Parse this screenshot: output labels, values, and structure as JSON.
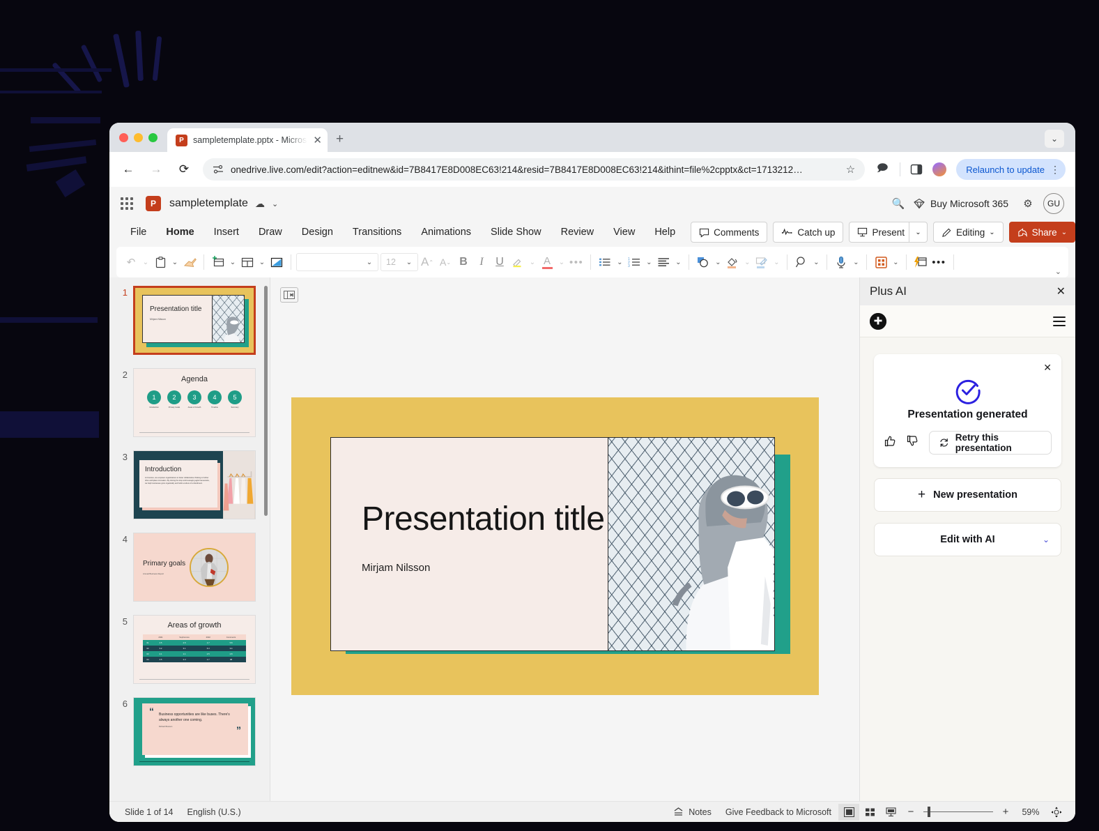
{
  "browser": {
    "tab": {
      "title": "sampletemplate.pptx - Micros",
      "favicon_icon": "powerpoint-icon",
      "close_icon": "close-icon"
    },
    "new_tab_icon": "plus-icon",
    "tabstrip_chevron_icon": "chevron-down-icon",
    "nav": {
      "back_icon": "arrow-left-icon",
      "forward_icon": "arrow-right-icon",
      "reload_icon": "reload-icon"
    },
    "omnibox": {
      "site_info_icon": "site-settings-icon",
      "url": "onedrive.live.com/edit?action=editnew&id=7B8417E8D008EC63!214&resid=7B8417E8D008EC63!214&ithint=file%2cpptx&ct=1713212…",
      "bookmark_icon": "star-icon"
    },
    "extensions_icon": "extensions-icon",
    "sidepanel_icon": "side-panel-icon",
    "profile_icon": "profile-avatar",
    "relaunch": {
      "label": "Relaunch to update",
      "menu_icon": "kebab-menu-icon"
    }
  },
  "office_header": {
    "waffle_icon": "app-launcher-icon",
    "app_badge": "P",
    "doc_title": "sampletemplate",
    "autosave_icon": "autosave-cloud-icon",
    "title_chevron_icon": "chevron-down-icon",
    "search_icon": "search-icon",
    "buy_label": "Buy Microsoft 365",
    "buy_icon": "diamond-icon",
    "settings_icon": "gear-icon",
    "account_initials": "GU"
  },
  "ribbon": {
    "tabs": [
      {
        "label": "File",
        "active": false
      },
      {
        "label": "Home",
        "active": true
      },
      {
        "label": "Insert",
        "active": false
      },
      {
        "label": "Draw",
        "active": false
      },
      {
        "label": "Design",
        "active": false
      },
      {
        "label": "Transitions",
        "active": false
      },
      {
        "label": "Animations",
        "active": false
      },
      {
        "label": "Slide Show",
        "active": false
      },
      {
        "label": "Review",
        "active": false
      },
      {
        "label": "View",
        "active": false
      },
      {
        "label": "Help",
        "active": false
      }
    ],
    "actions": {
      "comments": {
        "label": "Comments",
        "icon": "comment-icon"
      },
      "catch_up": {
        "label": "Catch up",
        "icon": "activity-icon"
      },
      "present": {
        "label": "Present",
        "icon": "present-icon",
        "chevron": "chevron-down-icon"
      },
      "editing": {
        "label": "Editing",
        "icon": "pencil-icon",
        "chevron": "chevron-down-icon"
      },
      "share": {
        "label": "Share",
        "icon": "share-icon",
        "chevron": "chevron-down-icon"
      }
    },
    "toolbar": {
      "undo_icon": "undo-icon",
      "paste_icon": "paste-clipboard-icon",
      "format_painter_icon": "format-painter-icon",
      "new_slide_icon": "new-slide-icon",
      "layout_icon": "slide-layout-icon",
      "reset_icon": "reset-slide-icon",
      "font_name": "",
      "font_name_placeholder": "",
      "font_size": "12",
      "grow_font_icon": "increase-font-size-icon",
      "shrink_font_icon": "decrease-font-size-icon",
      "bold_label": "B",
      "italic_label": "I",
      "underline_label": "U",
      "highlight_icon": "text-highlight-icon",
      "font_color_label": "A",
      "more_font_icon": "more-options-icon",
      "bullets_icon": "bulleted-list-icon",
      "numbering_icon": "numbered-list-icon",
      "align_icon": "align-left-icon",
      "shapes_icon": "shapes-icon",
      "shape_fill_icon": "shape-fill-icon",
      "shape_outline_icon": "shape-format-icon",
      "find_icon": "find-icon",
      "dictate_icon": "dictate-microphone-icon",
      "designer_icon": "designer-grid-icon",
      "plus_ai_icon": "plus-ai-addin-icon",
      "more_icon": "more-options-icon",
      "collapse_ribbon_icon": "chevron-down-icon"
    }
  },
  "slides_panel": {
    "collapse_icon": "collapse-panel-icon",
    "thumbnails": [
      {
        "number": "1",
        "selected": true,
        "kind": "title",
        "title": "Presentation title",
        "subtitle": "Mirjam Nilsson"
      },
      {
        "number": "2",
        "selected": false,
        "kind": "agenda",
        "title": "Agenda",
        "steps": [
          "1",
          "2",
          "3",
          "4",
          "5"
        ],
        "labels": [
          "Introduction",
          "Primary Goals",
          "Areas of Growth",
          "Timeline",
          "Summary"
        ]
      },
      {
        "number": "3",
        "selected": false,
        "kind": "introduction",
        "title": "Introduction",
        "body": "At Contoso, we empower organizations to foster collaborative thinking to further drive workplace innovation. By closing the loop and leveraging agile frameworks, we help businesses grow organically and build a culture of embodiment."
      },
      {
        "number": "4",
        "selected": false,
        "kind": "primary-goals",
        "title": "Primary goals",
        "subtitle": "Annual Business Report"
      },
      {
        "number": "5",
        "selected": false,
        "kind": "table",
        "title": "Areas of growth",
        "table": {
          "columns": [
            "",
            "2021",
            "Sophomore",
            "2022",
            "Comments"
          ],
          "rows": [
            [
              "01",
              "4.5",
              "2.5",
              "1.7",
              "5.8"
            ],
            [
              "02",
              "3.2",
              "3.1",
              "6.3",
              "3.4"
            ],
            [
              "03",
              "2.1",
              "1.1",
              "2.5",
              "2.8"
            ],
            [
              "04",
              "4.5",
              "2.3",
              "1.7",
              "08"
            ]
          ]
        }
      },
      {
        "number": "6",
        "selected": false,
        "kind": "quote",
        "quote": "Business opportunities are like buses. There's always another one coming.",
        "attribution": "Richard Branson"
      }
    ]
  },
  "slide_canvas": {
    "title": "Presentation title",
    "subtitle": "Mirjam Nilsson",
    "image_alt": "woman-in-hijab-by-mesh-wall",
    "colors": {
      "background": "#e8c35c",
      "card": "#f6ece8",
      "accent": "#21a08a"
    }
  },
  "ai_panel": {
    "title": "Plus AI",
    "close_icon": "close-icon",
    "logo_icon": "plus-ai-logo-icon",
    "menu_icon": "hamburger-menu-icon",
    "card": {
      "close_icon": "close-icon",
      "status_icon": "check-circle-icon",
      "status_text": "Presentation generated",
      "thumbs_up_icon": "thumbs-up-icon",
      "thumbs_down_icon": "thumbs-down-icon",
      "retry_label": "Retry this presentation",
      "retry_icon": "refresh-icon",
      "accent_color": "#2b20e0"
    },
    "new_presentation": {
      "label": "New presentation",
      "icon": "plus-icon"
    },
    "edit_with_ai": {
      "label": "Edit with AI",
      "chevron": "chevron-down-icon"
    }
  },
  "status_bar": {
    "slide_counter": "Slide 1 of 14",
    "language": "English (U.S.)",
    "notes": {
      "label": "Notes",
      "icon": "notes-icon"
    },
    "feedback_label": "Give Feedback to Microsoft",
    "view_normal_icon": "normal-view-icon",
    "view_sorter_icon": "slide-sorter-icon",
    "view_reading_icon": "reading-view-icon",
    "zoom_out_icon": "minus-icon",
    "zoom_in_icon": "plus-icon",
    "zoom_level": "59%",
    "fit_slide_icon": "fit-to-window-icon"
  }
}
